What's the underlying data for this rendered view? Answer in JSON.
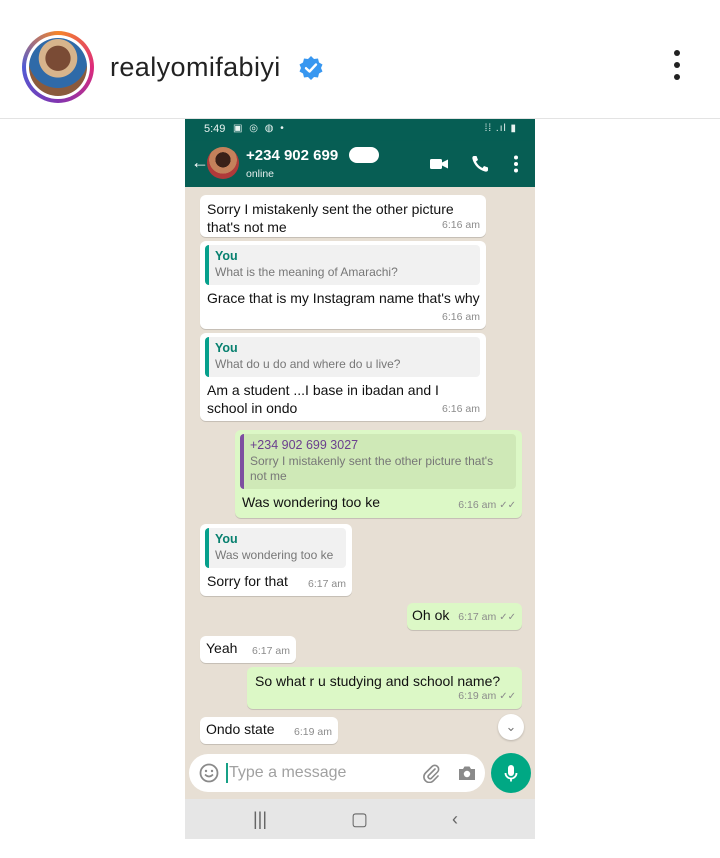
{
  "post": {
    "username": "realyomifabiyi",
    "verified": true,
    "brand_blue": "#3897f0"
  },
  "phone": {
    "status_time": "5:49",
    "contact_name": "+234 902 699",
    "contact_status": "online",
    "accent_dark": "#075e54",
    "accent_green": "#00a884"
  },
  "messages": [
    {
      "dir": "in",
      "text": "Sorry I mistakenly sent the other picture that's not me",
      "time": "6:16 am"
    },
    {
      "dir": "in",
      "quote_author": "You",
      "quote_text": "What is the meaning of Amarachi?",
      "text": "Grace that is my Instagram name that's why",
      "time": "6:16 am"
    },
    {
      "dir": "in",
      "quote_author": "You",
      "quote_text": "What do u do and where do u live?",
      "text": "Am a student ...I base in ibadan and I school in ondo",
      "time": "6:16 am"
    },
    {
      "dir": "out",
      "quote_author": "+234 902 699 3027",
      "quote_text": "Sorry I mistakenly sent the other picture that's not me",
      "text": "Was wondering too ke",
      "time": "6:16 am"
    },
    {
      "dir": "in",
      "quote_author": "You",
      "quote_text": "Was wondering too ke",
      "text": "Sorry for that",
      "time": "6:17 am"
    },
    {
      "dir": "out",
      "text": "Oh ok",
      "time": "6:17 am"
    },
    {
      "dir": "in",
      "text": "Yeah",
      "time": "6:17 am"
    },
    {
      "dir": "out",
      "text": "So what r u studying and school name?",
      "time": "6:19 am"
    },
    {
      "dir": "in",
      "text": "Ondo state",
      "time": "6:19 am"
    }
  ],
  "composer": {
    "placeholder": "Type a message"
  }
}
